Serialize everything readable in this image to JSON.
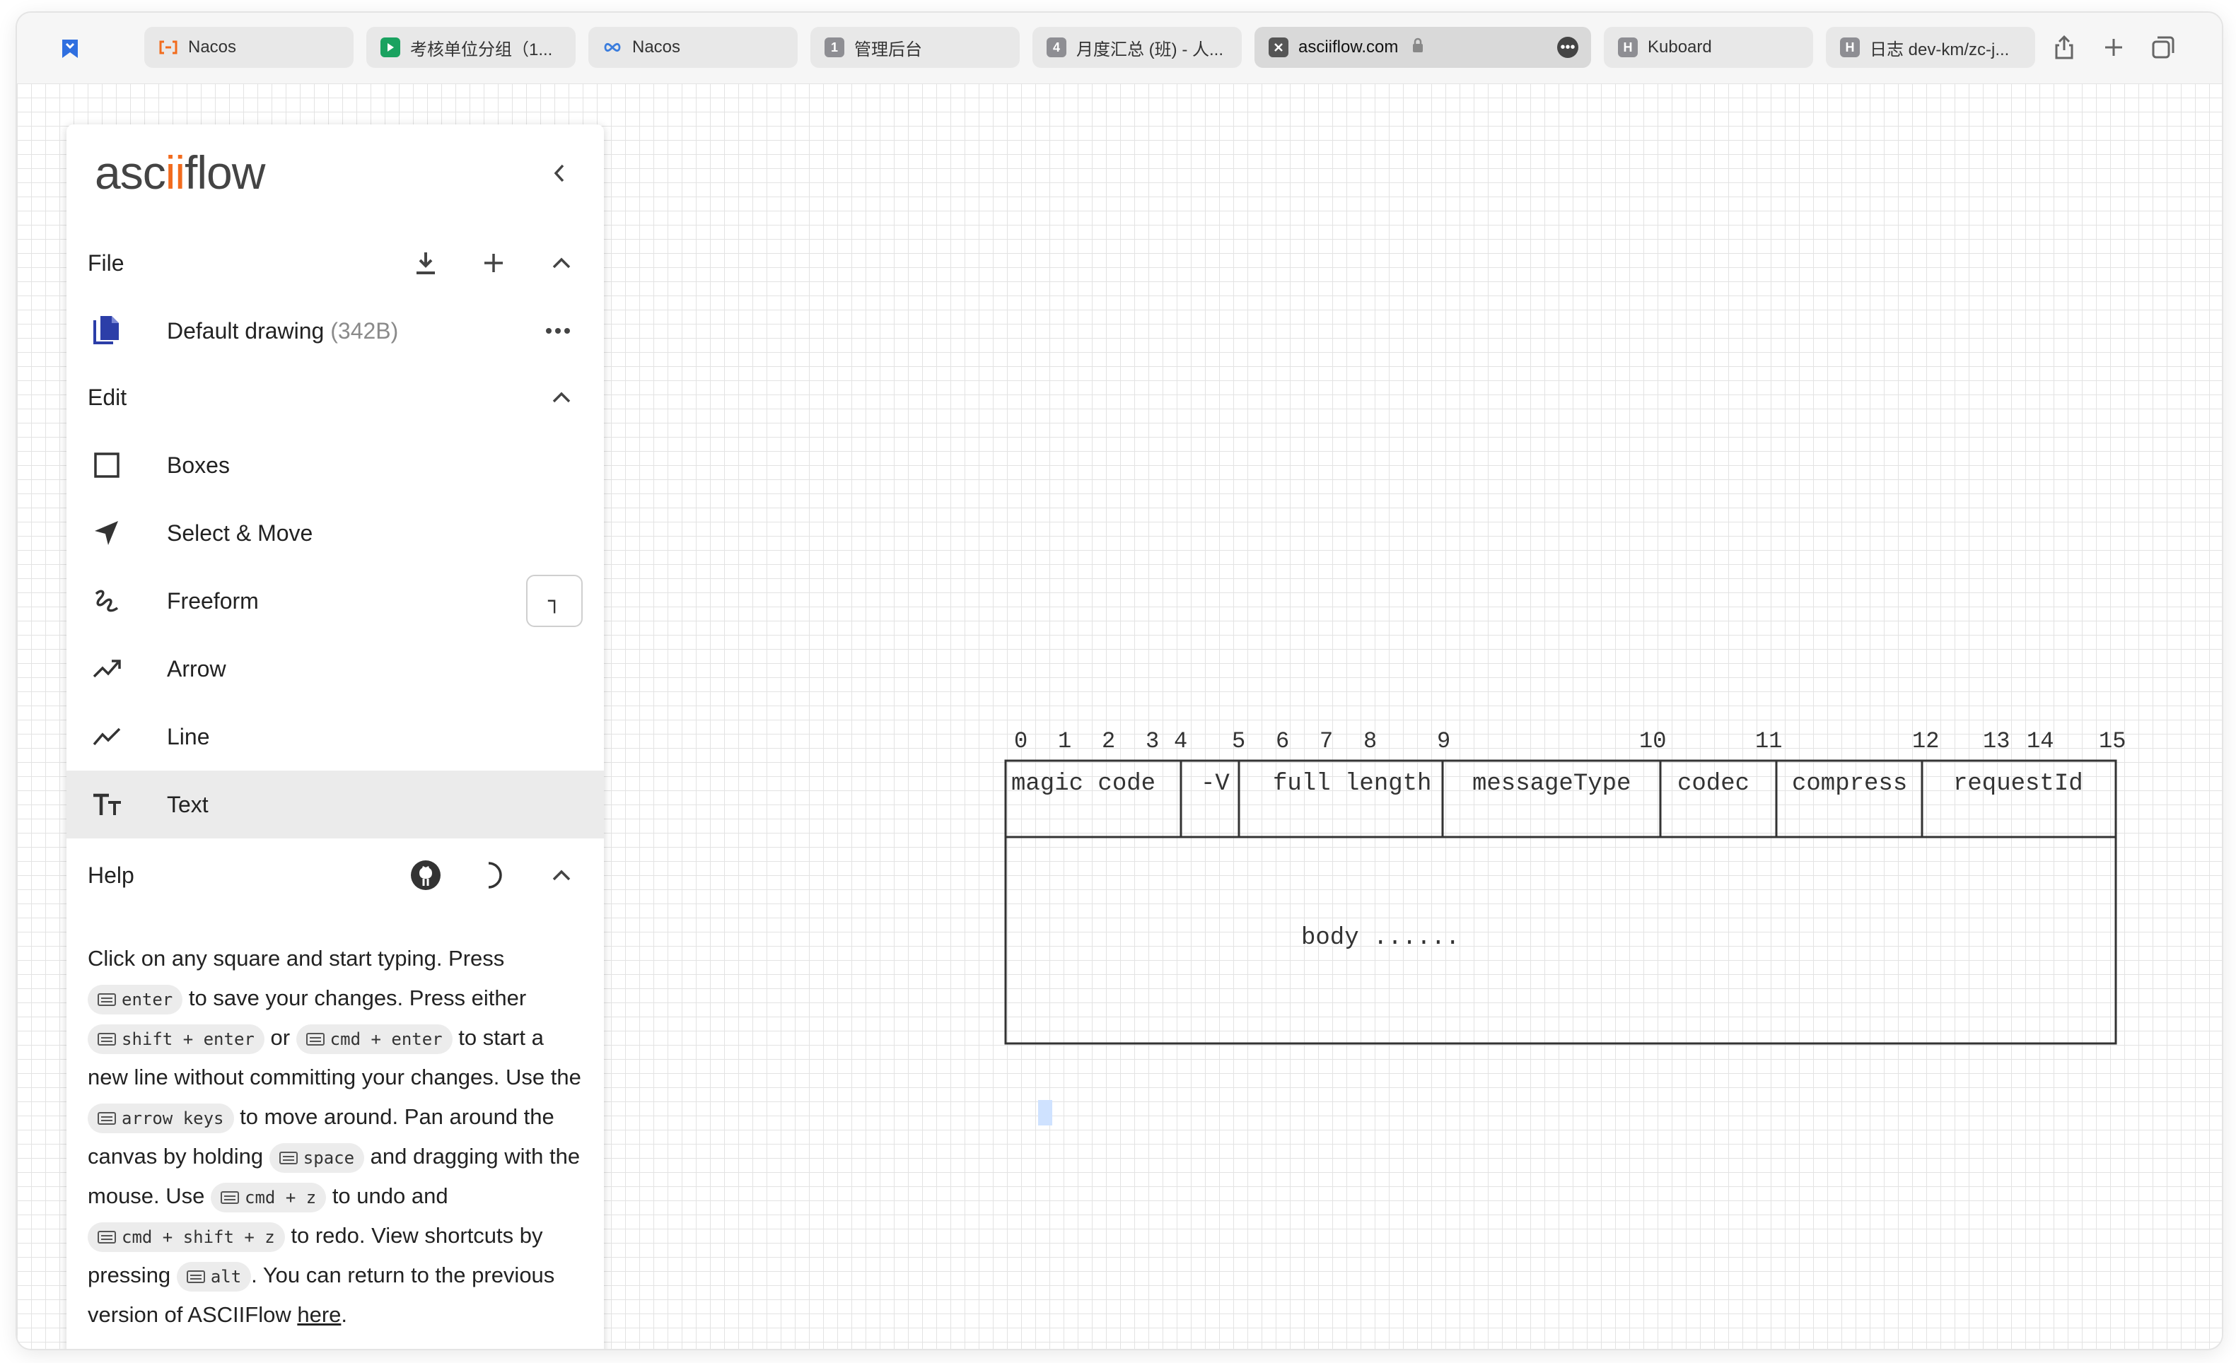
{
  "browser": {
    "tabs": [
      {
        "label": "Nacos",
        "favicon": "nacos-icon",
        "color": "#f26b1d"
      },
      {
        "label": "考核单位分组（1...",
        "favicon": "play-icon",
        "color": "#1aa260"
      },
      {
        "label": "Nacos",
        "favicon": "infinity-icon",
        "color": "#3b7ddd"
      },
      {
        "label": "管理后台",
        "favicon": "1",
        "color": "#8e8e93"
      },
      {
        "label": "月度汇总 (班) - 人...",
        "favicon": "4",
        "color": "#8e8e93"
      },
      {
        "label": "asciiflow.com",
        "favicon": "close-x",
        "color": "#555555",
        "active": true
      },
      {
        "label": "Kuboard",
        "favicon": "H",
        "color": "#8e8e93"
      },
      {
        "label": "日志 dev-km/zc-j...",
        "favicon": "H",
        "color": "#8e8e93"
      }
    ]
  },
  "app": {
    "logo": {
      "pre": "asc",
      "oo": "ii",
      "post": "flow"
    },
    "file": {
      "title": "File",
      "drawing_name": "Default drawing",
      "drawing_size": "(342B)"
    },
    "edit": {
      "title": "Edit",
      "tools": [
        {
          "label": "Boxes",
          "icon": "square-icon"
        },
        {
          "label": "Select & Move",
          "icon": "cursor-arrow-icon"
        },
        {
          "label": "Freeform",
          "icon": "squiggle-icon",
          "preview": "┐"
        },
        {
          "label": "Arrow",
          "icon": "trend-arrow-icon"
        },
        {
          "label": "Line",
          "icon": "trend-line-icon"
        },
        {
          "label": "Text",
          "icon": "text-icon",
          "selected": true
        }
      ]
    },
    "help": {
      "title": "Help",
      "t1": "Click on any square and start typing. Press",
      "k_enter": "enter",
      "t2": "to save your changes. Press either",
      "k_shift_enter": "shift + enter",
      "t3": "or",
      "k_cmd_enter": "cmd + enter",
      "t4": "to start a new line without committing your changes. Use the",
      "k_arrows": "arrow keys",
      "t5": "to move around. Pan around the canvas by holding",
      "k_space": "space",
      "t6": "and dragging with the mouse. Use",
      "k_undo": "cmd + z",
      "t7": "to undo and",
      "k_redo": "cmd + shift + z",
      "t8": "to redo. View shortcuts by pressing",
      "k_alt": "alt",
      "t9": ". You can return to the previous version of ASCIIFlow",
      "link": "here",
      "t10": "."
    }
  },
  "diagram": {
    "numbers": [
      "0",
      "1",
      "2",
      "3",
      "4",
      "5",
      "6",
      "7",
      "8",
      "9",
      "10",
      "11",
      "12",
      "13",
      "14",
      "15"
    ],
    "fields": [
      "magic code",
      "-V",
      "full length",
      "messageType",
      "codec",
      "compress",
      "requestId"
    ],
    "body": "body ......"
  }
}
